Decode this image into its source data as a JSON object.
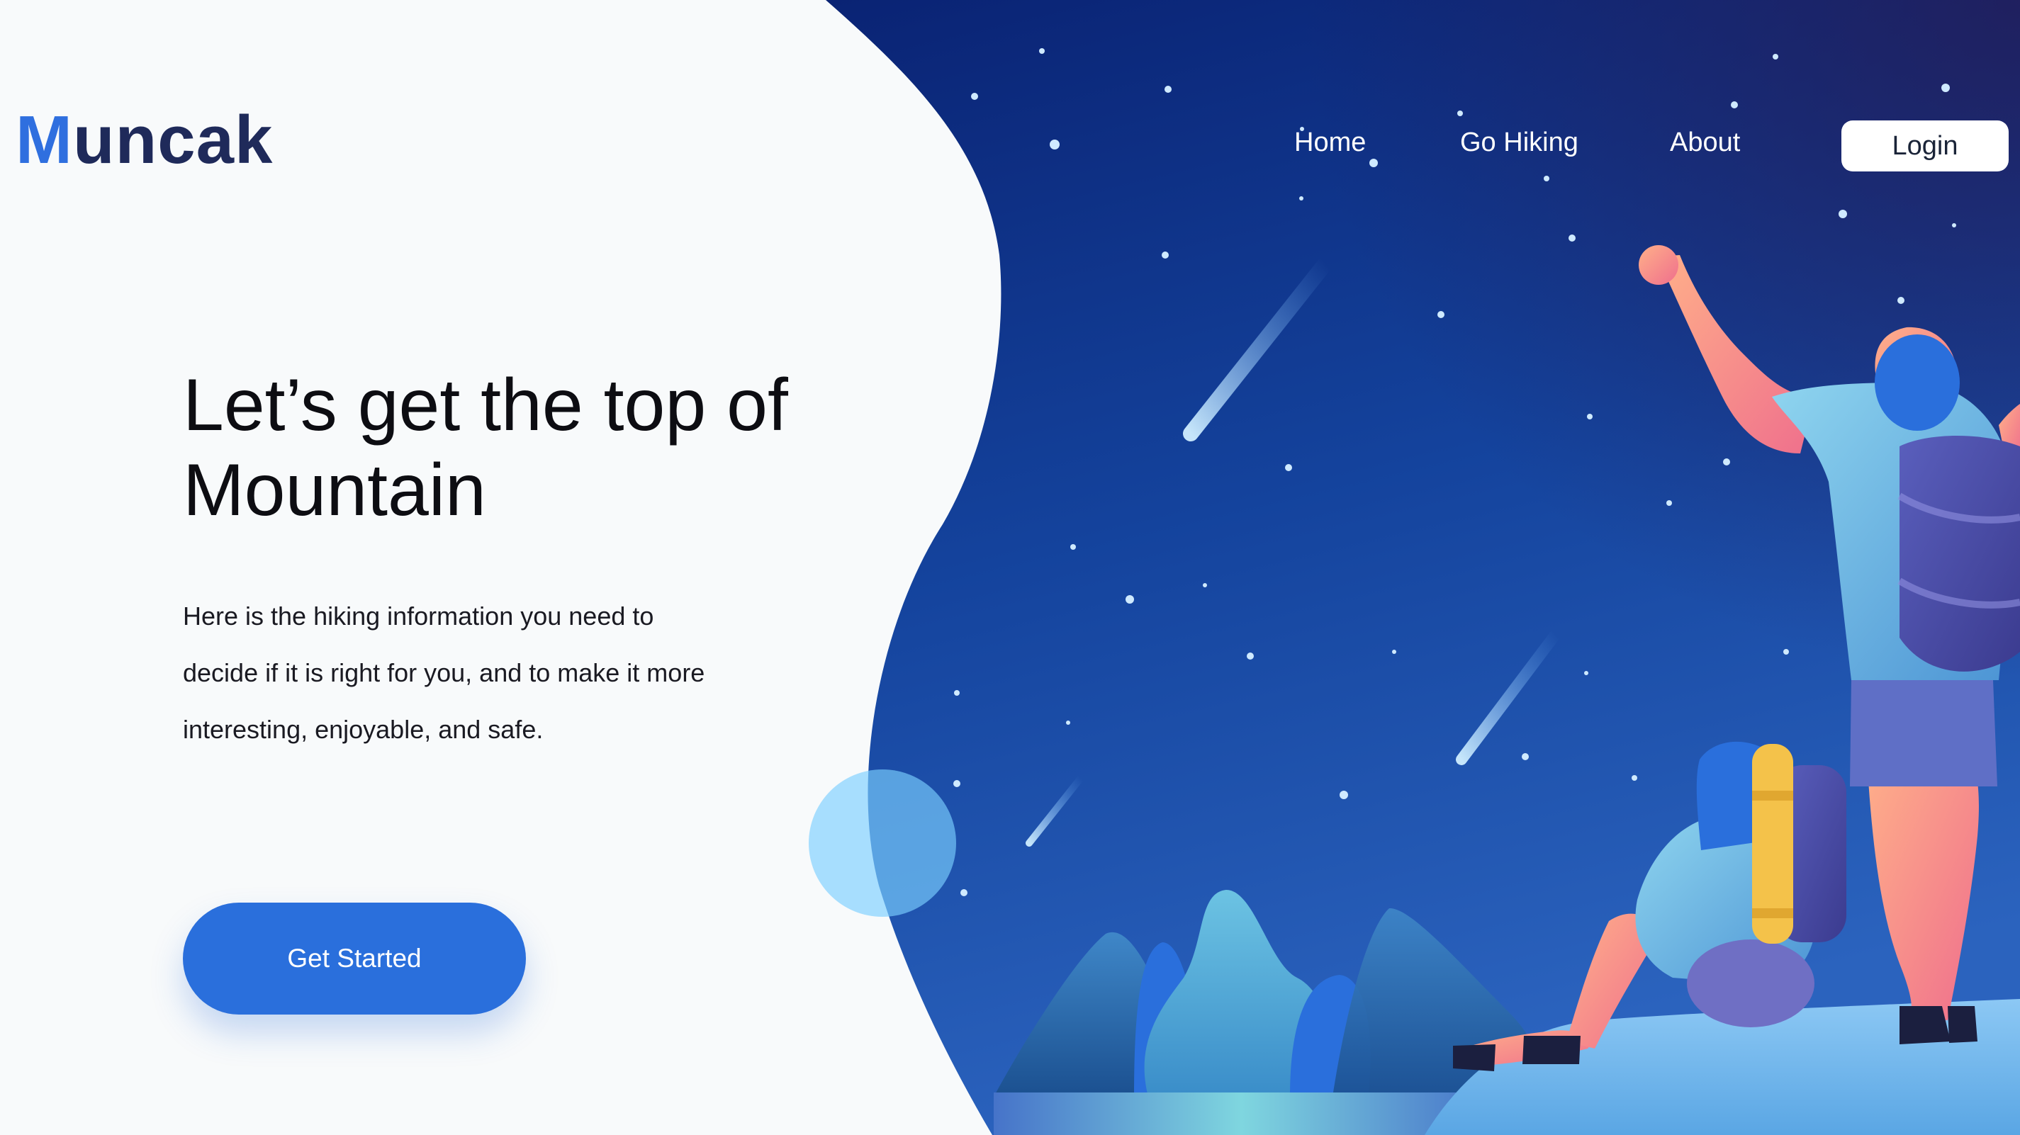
{
  "brand": {
    "name_initial": "M",
    "name_rest": "uncak"
  },
  "nav": {
    "items": [
      {
        "label": "Home"
      },
      {
        "label": "Go Hiking"
      },
      {
        "label": "About"
      }
    ],
    "login_label": "Login"
  },
  "hero": {
    "headline": "Let’s get the top of Mountain",
    "description": "Here is the hiking information you need to decide if it is right for you, and to make it more interesting, enjoyable, and safe.",
    "cta_label": "Get Started"
  },
  "colors": {
    "brand_accent": "#2f6fdf",
    "brand_dark": "#1f2a5a",
    "cta": "#2a6fdc",
    "night_sky_top": "#0a2374",
    "night_sky_bottom": "#2b63be",
    "page_background": "#f8fafb"
  },
  "illustration": {
    "subject": "two hikers on a mountaintop under a starry night sky with shooting stars"
  }
}
